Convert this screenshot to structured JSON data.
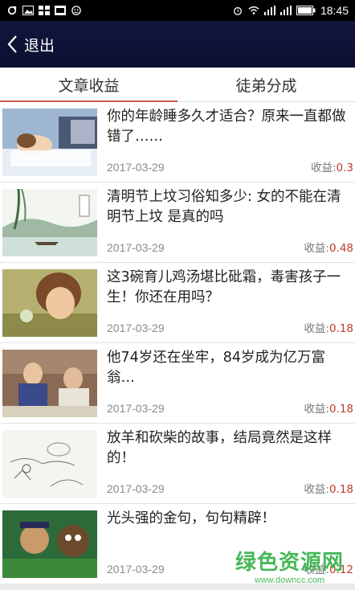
{
  "status_bar": {
    "time": "18:45",
    "left_icons": [
      "sync-icon",
      "image-icon",
      "grid-icon",
      "sim-icon",
      "smile-icon"
    ],
    "right_icons": [
      "alarm-icon",
      "wifi-icon",
      "signal-icon",
      "signal-icon",
      "battery-icon"
    ]
  },
  "header": {
    "back_label": "退出"
  },
  "tabs": [
    {
      "label": "文章收益",
      "active": true
    },
    {
      "label": "徒弟分成",
      "active": false
    }
  ],
  "articles": [
    {
      "title": "你的年龄睡多久才适合？原来一直都做错了……",
      "date": "2017-03-29",
      "earn_label": "收益:",
      "earn_value": "0.3"
    },
    {
      "title": "清明节上坟习俗知多少: 女的不能在清明节上坟 是真的吗",
      "date": "2017-03-29",
      "earn_label": "收益:",
      "earn_value": "0.48"
    },
    {
      "title": "这3碗育儿鸡汤堪比砒霜，毒害孩子一生！你还在用吗？",
      "date": "2017-03-29",
      "earn_label": "收益:",
      "earn_value": "0.18"
    },
    {
      "title": "他74岁还在坐牢，84岁成为亿万富翁…",
      "date": "2017-03-29",
      "earn_label": "收益:",
      "earn_value": "0.18"
    },
    {
      "title": "放羊和砍柴的故事，结局竟然是这样的！",
      "date": "2017-03-29",
      "earn_label": "收益:",
      "earn_value": "0.18"
    },
    {
      "title": "光头强的金句，句句精辟！",
      "date": "2017-03-29",
      "earn_label": "收益:",
      "earn_value": "0.12"
    }
  ],
  "watermark": {
    "main": "绿色资源网",
    "sub": "www.downcc.com"
  },
  "colors": {
    "header_bg": "#0b0f2e",
    "accent": "#c0392b",
    "watermark": "#38b24a"
  }
}
